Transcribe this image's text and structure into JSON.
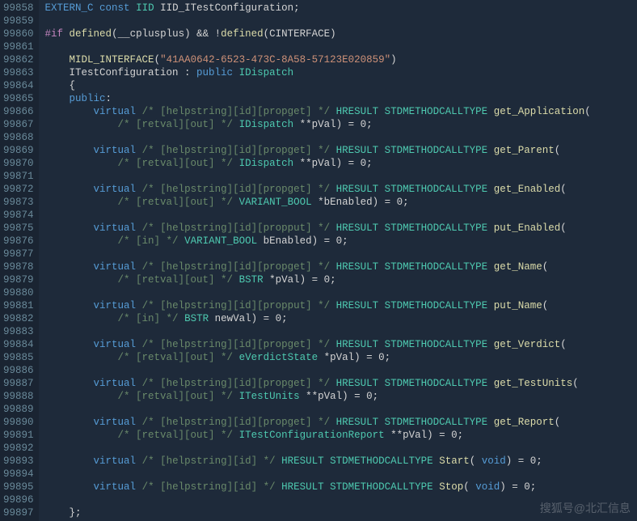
{
  "startLine": 99858,
  "watermark": "搜狐号@北汇信息",
  "lines": [
    {
      "t": [
        [
          "k",
          "EXTERN_C"
        ],
        [
          "n",
          " "
        ],
        [
          "k",
          "const"
        ],
        [
          "n",
          " "
        ],
        [
          "t",
          "IID"
        ],
        [
          "n",
          " IID_ITestConfiguration;"
        ]
      ]
    },
    {
      "t": []
    },
    {
      "t": [
        [
          "m",
          "#if"
        ],
        [
          "n",
          " "
        ],
        [
          "fn",
          "defined"
        ],
        [
          "n",
          "(__cplusplus) && !"
        ],
        [
          "fn",
          "defined"
        ],
        [
          "n",
          "(CINTERFACE)"
        ]
      ]
    },
    {
      "t": []
    },
    {
      "t": [
        [
          "n",
          "    "
        ],
        [
          "fn",
          "MIDL_INTERFACE"
        ],
        [
          "n",
          "("
        ],
        [
          "s",
          "\"41AA0642-6523-473C-8A58-57123E020859\""
        ],
        [
          "n",
          ")"
        ]
      ]
    },
    {
      "t": [
        [
          "n",
          "    ITestConfiguration : "
        ],
        [
          "k",
          "public"
        ],
        [
          "n",
          " "
        ],
        [
          "t",
          "IDispatch"
        ]
      ]
    },
    {
      "t": [
        [
          "n",
          "    {"
        ]
      ]
    },
    {
      "t": [
        [
          "n",
          "    "
        ],
        [
          "k",
          "public"
        ],
        [
          "n",
          ":"
        ]
      ]
    },
    {
      "t": [
        [
          "n",
          "        "
        ],
        [
          "k",
          "virtual"
        ],
        [
          "n",
          " "
        ],
        [
          "c",
          "/* [helpstring][id][propget] */"
        ],
        [
          "n",
          " "
        ],
        [
          "t",
          "HRESULT"
        ],
        [
          "n",
          " "
        ],
        [
          "t",
          "STDMETHODCALLTYPE"
        ],
        [
          "n",
          " "
        ],
        [
          "fn",
          "get_Application"
        ],
        [
          "n",
          "("
        ]
      ]
    },
    {
      "t": [
        [
          "n",
          "            "
        ],
        [
          "c",
          "/* [retval][out] */"
        ],
        [
          "n",
          " "
        ],
        [
          "t",
          "IDispatch"
        ],
        [
          "n",
          " **pVal) = 0;"
        ]
      ]
    },
    {
      "t": []
    },
    {
      "t": [
        [
          "n",
          "        "
        ],
        [
          "k",
          "virtual"
        ],
        [
          "n",
          " "
        ],
        [
          "c",
          "/* [helpstring][id][propget] */"
        ],
        [
          "n",
          " "
        ],
        [
          "t",
          "HRESULT"
        ],
        [
          "n",
          " "
        ],
        [
          "t",
          "STDMETHODCALLTYPE"
        ],
        [
          "n",
          " "
        ],
        [
          "fn",
          "get_Parent"
        ],
        [
          "n",
          "("
        ]
      ]
    },
    {
      "t": [
        [
          "n",
          "            "
        ],
        [
          "c",
          "/* [retval][out] */"
        ],
        [
          "n",
          " "
        ],
        [
          "t",
          "IDispatch"
        ],
        [
          "n",
          " **pVal) = 0;"
        ]
      ]
    },
    {
      "t": []
    },
    {
      "t": [
        [
          "n",
          "        "
        ],
        [
          "k",
          "virtual"
        ],
        [
          "n",
          " "
        ],
        [
          "c",
          "/* [helpstring][id][propget] */"
        ],
        [
          "n",
          " "
        ],
        [
          "t",
          "HRESULT"
        ],
        [
          "n",
          " "
        ],
        [
          "t",
          "STDMETHODCALLTYPE"
        ],
        [
          "n",
          " "
        ],
        [
          "fn",
          "get_Enabled"
        ],
        [
          "n",
          "("
        ]
      ]
    },
    {
      "t": [
        [
          "n",
          "            "
        ],
        [
          "c",
          "/* [retval][out] */"
        ],
        [
          "n",
          " "
        ],
        [
          "t",
          "VARIANT_BOOL"
        ],
        [
          "n",
          " *bEnabled) = 0;"
        ]
      ]
    },
    {
      "t": []
    },
    {
      "t": [
        [
          "n",
          "        "
        ],
        [
          "k",
          "virtual"
        ],
        [
          "n",
          " "
        ],
        [
          "c",
          "/* [helpstring][id][propput] */"
        ],
        [
          "n",
          " "
        ],
        [
          "t",
          "HRESULT"
        ],
        [
          "n",
          " "
        ],
        [
          "t",
          "STDMETHODCALLTYPE"
        ],
        [
          "n",
          " "
        ],
        [
          "fn",
          "put_Enabled"
        ],
        [
          "n",
          "("
        ]
      ]
    },
    {
      "t": [
        [
          "n",
          "            "
        ],
        [
          "c",
          "/* [in] */"
        ],
        [
          "n",
          " "
        ],
        [
          "t",
          "VARIANT_BOOL"
        ],
        [
          "n",
          " bEnabled) = 0;"
        ]
      ]
    },
    {
      "t": []
    },
    {
      "t": [
        [
          "n",
          "        "
        ],
        [
          "k",
          "virtual"
        ],
        [
          "n",
          " "
        ],
        [
          "c",
          "/* [helpstring][id][propget] */"
        ],
        [
          "n",
          " "
        ],
        [
          "t",
          "HRESULT"
        ],
        [
          "n",
          " "
        ],
        [
          "t",
          "STDMETHODCALLTYPE"
        ],
        [
          "n",
          " "
        ],
        [
          "fn",
          "get_Name"
        ],
        [
          "n",
          "("
        ]
      ]
    },
    {
      "t": [
        [
          "n",
          "            "
        ],
        [
          "c",
          "/* [retval][out] */"
        ],
        [
          "n",
          " "
        ],
        [
          "t",
          "BSTR"
        ],
        [
          "n",
          " *pVal) = 0;"
        ]
      ]
    },
    {
      "t": []
    },
    {
      "t": [
        [
          "n",
          "        "
        ],
        [
          "k",
          "virtual"
        ],
        [
          "n",
          " "
        ],
        [
          "c",
          "/* [helpstring][id][propput] */"
        ],
        [
          "n",
          " "
        ],
        [
          "t",
          "HRESULT"
        ],
        [
          "n",
          " "
        ],
        [
          "t",
          "STDMETHODCALLTYPE"
        ],
        [
          "n",
          " "
        ],
        [
          "fn",
          "put_Name"
        ],
        [
          "n",
          "("
        ]
      ]
    },
    {
      "t": [
        [
          "n",
          "            "
        ],
        [
          "c",
          "/* [in] */"
        ],
        [
          "n",
          " "
        ],
        [
          "t",
          "BSTR"
        ],
        [
          "n",
          " newVal) = 0;"
        ]
      ]
    },
    {
      "t": []
    },
    {
      "t": [
        [
          "n",
          "        "
        ],
        [
          "k",
          "virtual"
        ],
        [
          "n",
          " "
        ],
        [
          "c",
          "/* [helpstring][id][propget] */"
        ],
        [
          "n",
          " "
        ],
        [
          "t",
          "HRESULT"
        ],
        [
          "n",
          " "
        ],
        [
          "t",
          "STDMETHODCALLTYPE"
        ],
        [
          "n",
          " "
        ],
        [
          "fn",
          "get_Verdict"
        ],
        [
          "n",
          "("
        ]
      ]
    },
    {
      "t": [
        [
          "n",
          "            "
        ],
        [
          "c",
          "/* [retval][out] */"
        ],
        [
          "n",
          " "
        ],
        [
          "t",
          "eVerdictState"
        ],
        [
          "n",
          " *pVal) = 0;"
        ]
      ]
    },
    {
      "t": []
    },
    {
      "t": [
        [
          "n",
          "        "
        ],
        [
          "k",
          "virtual"
        ],
        [
          "n",
          " "
        ],
        [
          "c",
          "/* [helpstring][id][propget] */"
        ],
        [
          "n",
          " "
        ],
        [
          "t",
          "HRESULT"
        ],
        [
          "n",
          " "
        ],
        [
          "t",
          "STDMETHODCALLTYPE"
        ],
        [
          "n",
          " "
        ],
        [
          "fn",
          "get_TestUnits"
        ],
        [
          "n",
          "("
        ]
      ]
    },
    {
      "t": [
        [
          "n",
          "            "
        ],
        [
          "c",
          "/* [retval][out] */"
        ],
        [
          "n",
          " "
        ],
        [
          "t",
          "ITestUnits"
        ],
        [
          "n",
          " **pVal) = 0;"
        ]
      ]
    },
    {
      "t": []
    },
    {
      "t": [
        [
          "n",
          "        "
        ],
        [
          "k",
          "virtual"
        ],
        [
          "n",
          " "
        ],
        [
          "c",
          "/* [helpstring][id][propget] */"
        ],
        [
          "n",
          " "
        ],
        [
          "t",
          "HRESULT"
        ],
        [
          "n",
          " "
        ],
        [
          "t",
          "STDMETHODCALLTYPE"
        ],
        [
          "n",
          " "
        ],
        [
          "fn",
          "get_Report"
        ],
        [
          "n",
          "("
        ]
      ]
    },
    {
      "t": [
        [
          "n",
          "            "
        ],
        [
          "c",
          "/* [retval][out] */"
        ],
        [
          "n",
          " "
        ],
        [
          "t",
          "ITestConfigurationReport"
        ],
        [
          "n",
          " **pVal) = 0;"
        ]
      ]
    },
    {
      "t": []
    },
    {
      "t": [
        [
          "n",
          "        "
        ],
        [
          "k",
          "virtual"
        ],
        [
          "n",
          " "
        ],
        [
          "c",
          "/* [helpstring][id] */"
        ],
        [
          "n",
          " "
        ],
        [
          "t",
          "HRESULT"
        ],
        [
          "n",
          " "
        ],
        [
          "t",
          "STDMETHODCALLTYPE"
        ],
        [
          "n",
          " "
        ],
        [
          "fn",
          "Start"
        ],
        [
          "n",
          "( "
        ],
        [
          "k",
          "void"
        ],
        [
          "n",
          ") = 0;"
        ]
      ]
    },
    {
      "t": []
    },
    {
      "t": [
        [
          "n",
          "        "
        ],
        [
          "k",
          "virtual"
        ],
        [
          "n",
          " "
        ],
        [
          "c",
          "/* [helpstring][id] */"
        ],
        [
          "n",
          " "
        ],
        [
          "t",
          "HRESULT"
        ],
        [
          "n",
          " "
        ],
        [
          "t",
          "STDMETHODCALLTYPE"
        ],
        [
          "n",
          " "
        ],
        [
          "fn",
          "Stop"
        ],
        [
          "n",
          "( "
        ],
        [
          "k",
          "void"
        ],
        [
          "n",
          ") = 0;"
        ]
      ]
    },
    {
      "t": []
    },
    {
      "t": [
        [
          "n",
          "    };"
        ]
      ]
    }
  ]
}
